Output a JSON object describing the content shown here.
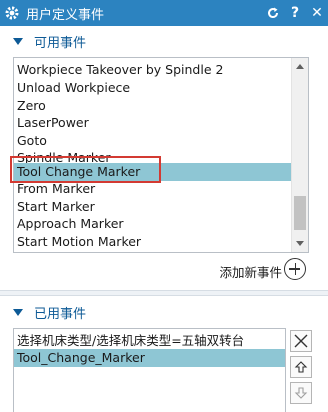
{
  "title": "用户定义事件",
  "title_buttons": [
    "reset-icon",
    "help-icon",
    "close-icon"
  ],
  "available": {
    "header": "可用事件",
    "items": [
      {
        "label": "Workpiece Takeover by Spindle 2",
        "selected": false
      },
      {
        "label": "Unload Workpiece",
        "selected": false
      },
      {
        "label": "Zero",
        "selected": false
      },
      {
        "label": "LaserPower",
        "selected": false
      },
      {
        "label": "Goto",
        "selected": false
      },
      {
        "label": "Spindle Marker",
        "selected": false
      },
      {
        "label": "Tool Change Marker",
        "selected": true
      },
      {
        "label": "From Marker",
        "selected": false
      },
      {
        "label": "Start Marker",
        "selected": false
      },
      {
        "label": "Approach Marker",
        "selected": false
      },
      {
        "label": "Start Motion Marker",
        "selected": false
      }
    ],
    "add_label": "添加新事件"
  },
  "used": {
    "header": "已用事件",
    "items": [
      {
        "label": "选择机床类型/选择机床类型=五轴双转台",
        "selected": false
      },
      {
        "label": "Tool_Change_Marker",
        "selected": true
      }
    ]
  },
  "colors": {
    "titlebar": "#2c83c0",
    "selection": "#8ec6d4",
    "highlight_border": "#d33a32",
    "section_text": "#0d5a96"
  }
}
